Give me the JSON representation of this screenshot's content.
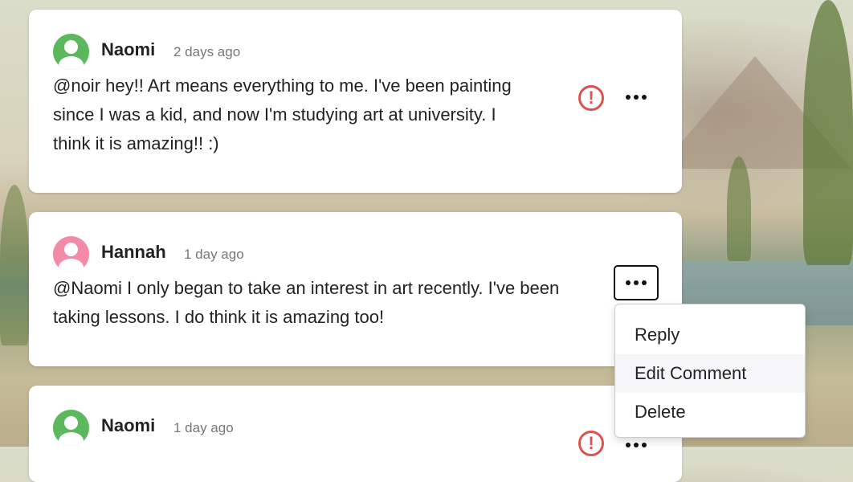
{
  "comments": [
    {
      "author": "Naomi",
      "time": "2 days ago",
      "avatar_color": "#5cb85c",
      "text_lines": [
        "@noir hey!! Art means everything to me. I've been painting",
        "since I was a kid, and now I'm studying art at university. I",
        "think it is amazing!! :)"
      ],
      "report_icon": "exclamation-circle-icon",
      "more_icon": "ellipsis-icon"
    },
    {
      "author": "Hannah",
      "time": "1 day ago",
      "avatar_color": "#f28aa8",
      "text_lines": [
        "@Naomi I only began to take an interest in art recently. I've been",
        "taking lessons. I do think it is amazing too!"
      ],
      "more_icon": "ellipsis-icon"
    },
    {
      "author": "Naomi",
      "time": "1 day ago",
      "avatar_color": "#5cb85c",
      "report_icon": "exclamation-circle-icon",
      "more_icon": "ellipsis-icon"
    }
  ],
  "menu": {
    "items": [
      "Reply",
      "Edit Comment",
      "Delete"
    ],
    "highlighted": "Edit Comment"
  },
  "colors": {
    "report_red": "#d9534f"
  }
}
